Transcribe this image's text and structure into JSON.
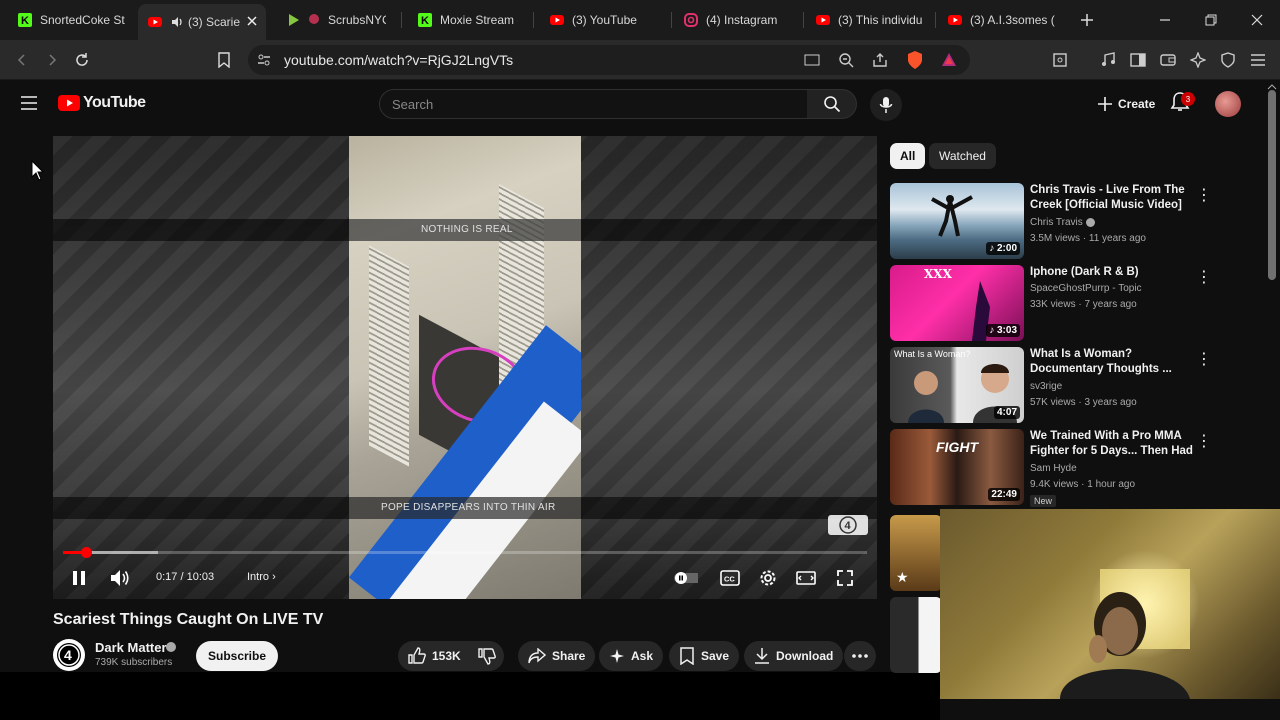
{
  "browser": {
    "tabs": [
      {
        "label": "SnortedCoke St",
        "icon": "kick-icon",
        "color": "#53fc18"
      },
      {
        "label": "(3) Scarie",
        "icon": "youtube-icon",
        "color": "#ff0000",
        "active": true
      },
      {
        "label": "ScrubsNYC",
        "icon": "rumble-icon",
        "color": "#85c742"
      },
      {
        "label": "Moxie Stream -",
        "icon": "kick-icon",
        "color": "#53fc18"
      },
      {
        "label": "(3) YouTube",
        "icon": "youtube-icon",
        "color": "#ff0000"
      },
      {
        "label": "(4) Instagram",
        "icon": "instagram-icon",
        "color": "#e1306c"
      },
      {
        "label": "(3) This individu",
        "icon": "youtube-icon",
        "color": "#ff0000"
      },
      {
        "label": "(3) A.I.3somes (",
        "icon": "youtube-icon",
        "color": "#ff0000"
      }
    ],
    "url": "youtube.com/watch?v=RjGJ2LngVTs"
  },
  "youtube": {
    "logo_text": "YouTube",
    "search_placeholder": "Search",
    "create_label": "Create",
    "notification_count": "3"
  },
  "video": {
    "caption_top": "NOTHING IS REAL",
    "caption_bottom": "POPE DISAPPEARS INTO THIN AIR",
    "chip_number": "4",
    "time": "0:17 / 10:03",
    "chapter": "Intro",
    "progress_fraction": 0.028,
    "title": "Scariest Things Caught On LIVE TV",
    "channel_name": "Dark Matter",
    "channel_subs": "739K subscribers",
    "subscribe_label": "Subscribe",
    "likes": "153K",
    "share_label": "Share",
    "ask_label": "Ask",
    "save_label": "Save",
    "download_label": "Download"
  },
  "sidebar": {
    "chips": [
      "All",
      "Watched"
    ],
    "recommendations": [
      {
        "title": "Chris Travis - Live From The Creek [Official Music Video]",
        "channel": "Chris Travis",
        "meta": "3.5M views · 11 years ago",
        "duration": "2:00"
      },
      {
        "title": "Iphone (Dark R & B)",
        "channel": "SpaceGhostPurrp - Topic",
        "meta": "33K views · 7 years ago",
        "duration": "3:03"
      },
      {
        "title": "What Is a Woman? Documentary Thoughts ...",
        "channel": "sv3rige",
        "meta": "57K views · 3 years ago",
        "duration": "4:07"
      },
      {
        "title": "We Trained With a Pro MMA Fighter for 5 Days... Then Had ...",
        "channel": "Sam Hyde",
        "meta": "9.4K views · 1 hour ago",
        "duration": "22:49",
        "badge": "New"
      }
    ],
    "thumb3_text": "What Is a Woman?",
    "thumb2_text": "XXX",
    "thumb4_text": "FIGHT"
  }
}
